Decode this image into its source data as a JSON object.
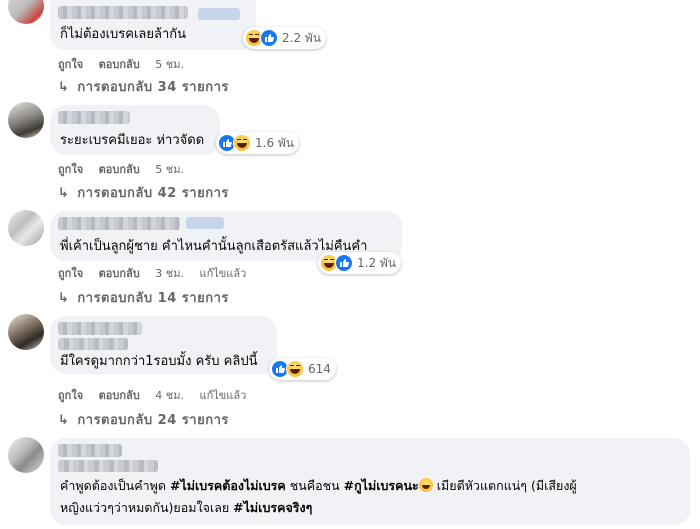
{
  "comments": [
    {
      "text": "ก็ไม่ต้องเบรคเลยล้ากัน",
      "reaction_count": "2.2 พัน",
      "like": "ถูกใจ",
      "reply": "ตอบกลับ",
      "time": "5 ชม.",
      "edited": "",
      "replies_label": "การตอบกลับ 34 รายการ"
    },
    {
      "text": "ระยะเบรคมีเยอะ ห่าวจัดด",
      "reaction_count": "1.6 พัน",
      "like": "ถูกใจ",
      "reply": "ตอบกลับ",
      "time": "5 ชม.",
      "edited": "",
      "replies_label": "การตอบกลับ 42 รายการ"
    },
    {
      "text": "พี่เค้าเป็นลูกผู้ชาย คำไหนคำนั้นลูกเสือตรัสแล้วไม่คืนคำ",
      "reaction_count": "1.2 พัน",
      "like": "ถูกใจ",
      "reply": "ตอบกลับ",
      "time": "3 ชม.",
      "edited": "แก้ไขแล้ว",
      "replies_label": "การตอบกลับ 14 รายการ"
    },
    {
      "text": "มีใครดูมากกว่า1รอบมั้ง ครับ คลิปนี้",
      "reaction_count": "614",
      "like": "ถูกใจ",
      "reply": "ตอบกลับ",
      "time": "4 ชม.",
      "edited": "แก้ไขแล้ว",
      "replies_label": "การตอบกลับ 24 รายการ"
    },
    {
      "line1_a": "คำพูดต้องเป็นคำพูด ",
      "line1_tag1": "#ไม่เบรคต้องไม่เบรค",
      "line1_b": " ชนคือชน ",
      "line1_tag2": "#กูไม่เบรคนะ",
      "line1_c": " เมียตีหัวแตกแน่ๆ (มีเสียงผู้",
      "line2_a": "หญิงแว่วๆว่าหมดกัน)ยอมใจเลย ",
      "line2_tag": "#ไม่เบรคจริงๆ"
    }
  ],
  "colors": {
    "bubble": "#f0f2f5",
    "secondary_text": "#65676b",
    "like_blue": "#1877f2",
    "haha_yellow": "#f7b125"
  },
  "icons": [
    "like-icon",
    "haha-icon",
    "reply-arrow-icon"
  ]
}
